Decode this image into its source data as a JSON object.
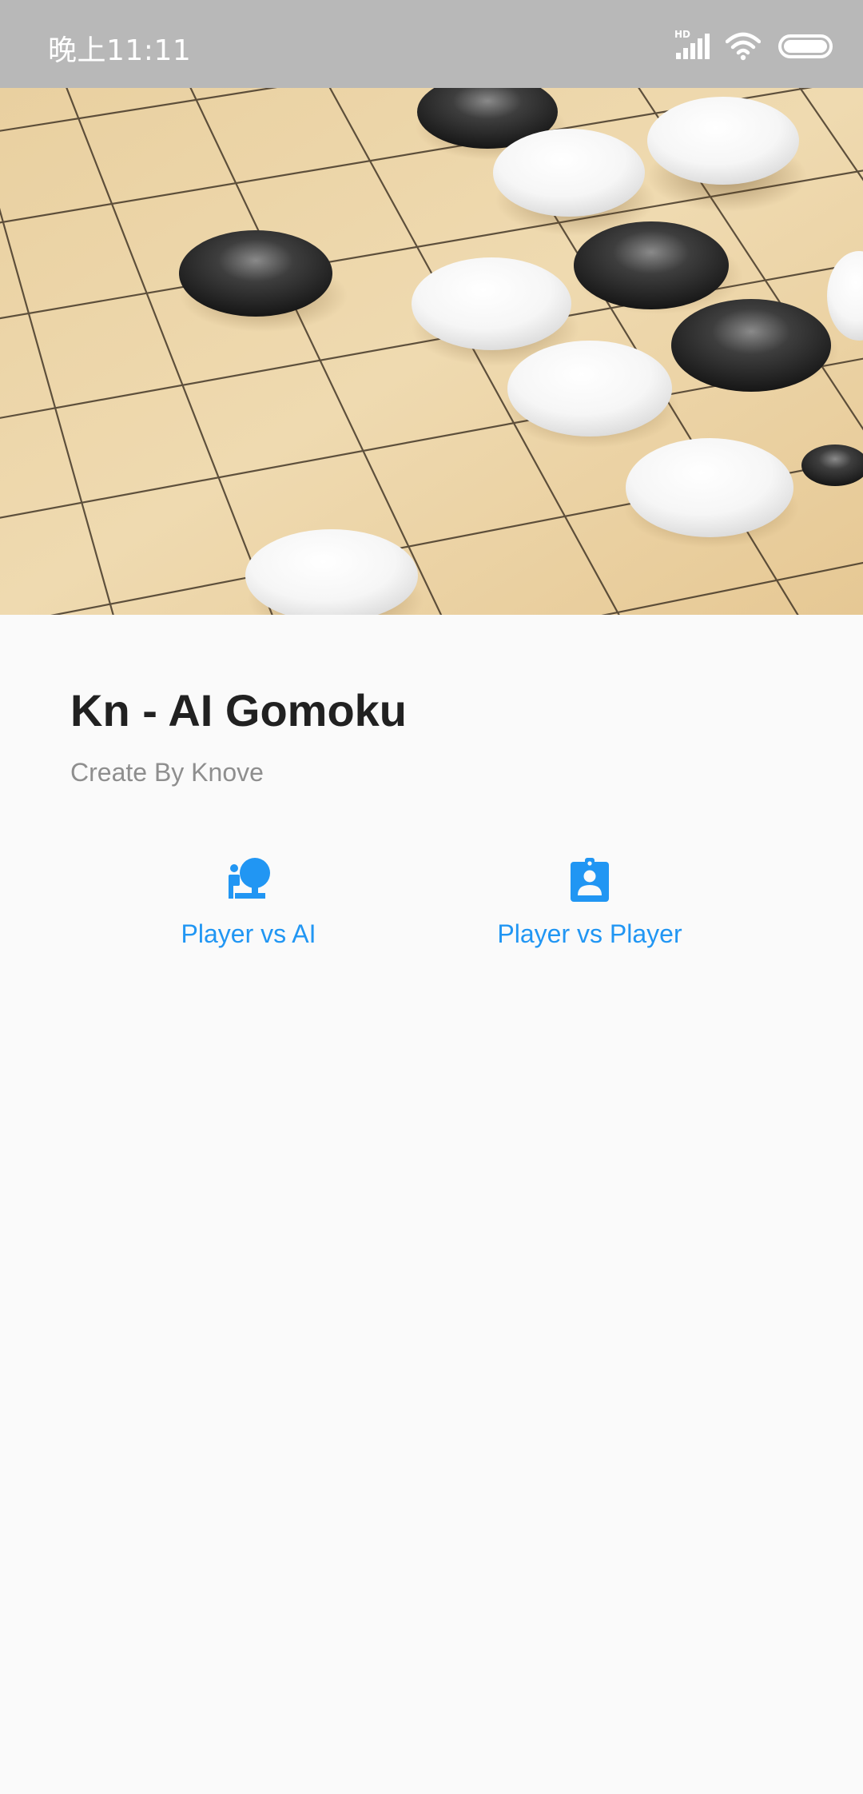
{
  "status_bar": {
    "time": "晚上11:11",
    "network_badge": "HD",
    "icons": [
      "signal-icon",
      "wifi-icon",
      "battery-icon"
    ]
  },
  "hero": {
    "image": "gomoku-board-photo"
  },
  "app": {
    "title": "Kn - AI Gomoku",
    "subtitle": "Create By Knove"
  },
  "modes": [
    {
      "label": "Player vs AI",
      "icon": "person-with-ai-icon"
    },
    {
      "label": "Player vs Player",
      "icon": "contact-badge-icon"
    }
  ],
  "colors": {
    "accent": "#2196f3",
    "status_bar": "#b8b8b8",
    "background": "#fafafa",
    "title": "#212121",
    "subtitle": "#8e8e8e"
  }
}
